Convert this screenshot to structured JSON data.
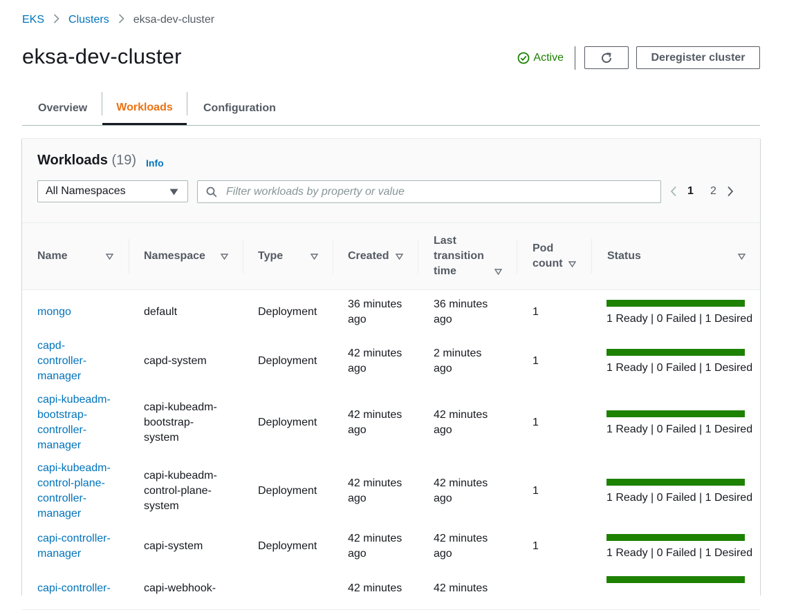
{
  "breadcrumb": {
    "root": "EKS",
    "clusters": "Clusters",
    "current": "eksa-dev-cluster"
  },
  "header": {
    "title": "eksa-dev-cluster",
    "status": "Active",
    "deregister_label": "Deregister cluster"
  },
  "tabs": [
    {
      "label": "Overview",
      "active": false
    },
    {
      "label": "Workloads",
      "active": true
    },
    {
      "label": "Configuration",
      "active": false
    }
  ],
  "workloads": {
    "title": "Workloads",
    "count": "(19)",
    "info": "Info",
    "namespace_select": "All Namespaces",
    "filter_placeholder": "Filter workloads by property or value",
    "pages": [
      "1",
      "2"
    ],
    "current_page": "1"
  },
  "table": {
    "columns": {
      "name": "Name",
      "namespace": "Namespace",
      "type": "Type",
      "created": "Created",
      "last_transition_1": "Last",
      "last_transition_2": "transition",
      "last_transition_3": "time",
      "pod_count_1": "Pod",
      "pod_count_2": "count",
      "status": "Status"
    },
    "rows": [
      {
        "name": [
          "mongo"
        ],
        "namespace": [
          "default"
        ],
        "type": "Deployment",
        "created": [
          "36 minutes",
          "ago"
        ],
        "last": [
          "36 minutes",
          "ago"
        ],
        "pods": "1",
        "status": "1 Ready | 0 Failed | 1 Desired"
      },
      {
        "name": [
          "capd-",
          "controller-",
          "manager"
        ],
        "namespace": [
          "capd-system"
        ],
        "type": "Deployment",
        "created": [
          "42 minutes",
          "ago"
        ],
        "last": [
          "2 minutes",
          "ago"
        ],
        "pods": "1",
        "status": "1 Ready | 0 Failed | 1 Desired"
      },
      {
        "name": [
          "capi-kubeadm-",
          "bootstrap-",
          "controller-",
          "manager"
        ],
        "namespace": [
          "capi-kubeadm-",
          "bootstrap-",
          "system"
        ],
        "type": "Deployment",
        "created": [
          "42 minutes",
          "ago"
        ],
        "last": [
          "42 minutes",
          "ago"
        ],
        "pods": "1",
        "status": "1 Ready | 0 Failed | 1 Desired"
      },
      {
        "name": [
          "capi-kubeadm-",
          "control-plane-",
          "controller-",
          "manager"
        ],
        "namespace": [
          "capi-kubeadm-",
          "control-plane-",
          "system"
        ],
        "type": "Deployment",
        "created": [
          "42 minutes",
          "ago"
        ],
        "last": [
          "42 minutes",
          "ago"
        ],
        "pods": "1",
        "status": "1 Ready | 0 Failed | 1 Desired"
      },
      {
        "name": [
          "capi-controller-",
          "manager"
        ],
        "namespace": [
          "capi-system"
        ],
        "type": "Deployment",
        "created": [
          "42 minutes",
          "ago"
        ],
        "last": [
          "42 minutes",
          "ago"
        ],
        "pods": "1",
        "status": "1 Ready | 0 Failed | 1 Desired"
      },
      {
        "name": [
          "capi-controller-"
        ],
        "namespace": [
          "capi-webhook-"
        ],
        "type": "",
        "created": [
          "42 minutes"
        ],
        "last": [
          "42 minutes"
        ],
        "pods": "",
        "status": ""
      }
    ]
  },
  "colors": {
    "link": "#0073bb",
    "success": "#1d8102",
    "active_tab": "#ec7211"
  }
}
